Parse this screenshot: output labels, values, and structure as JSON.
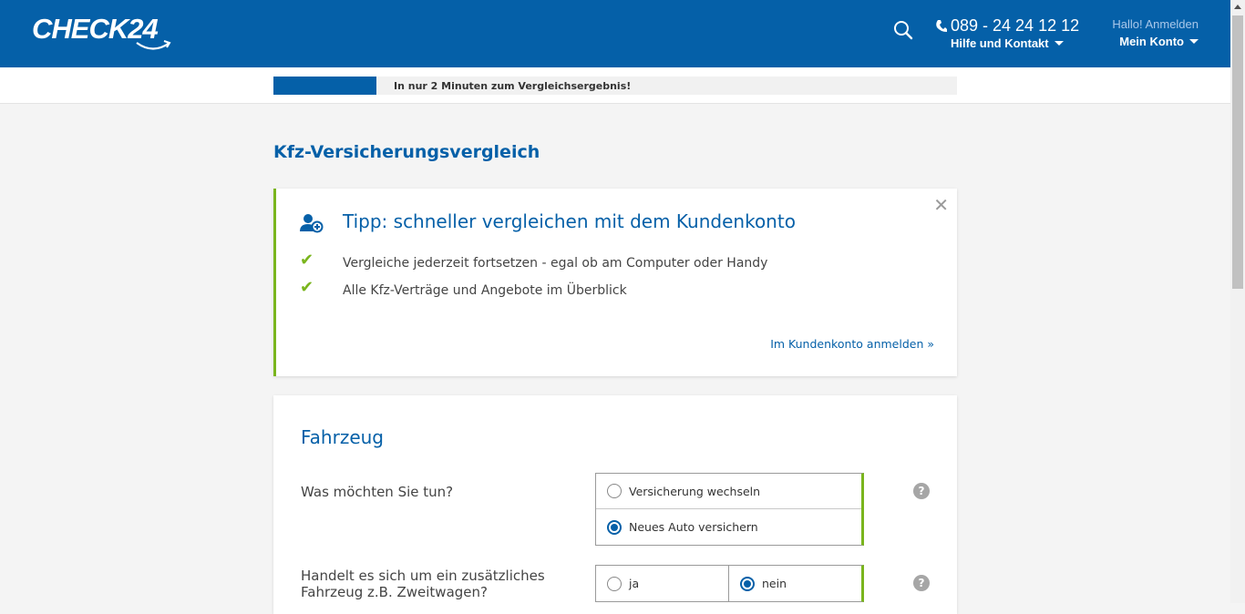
{
  "header": {
    "logo_text": "CHECK24",
    "phone": "089 - 24 24 12 12",
    "help_label": "Hilfe und Kontakt",
    "greeting": "Hallo! Anmelden",
    "account_label": "Mein Konto",
    "brand_color": "#0560a8"
  },
  "progress": {
    "fraction": 0.15,
    "text": "In nur 2 Minuten zum Vergleichsergebnis!"
  },
  "page_title": "Kfz-Versicherungsvergleich",
  "tip": {
    "title": "Tipp: schneller vergleichen mit dem Kundenkonto",
    "items": [
      "Vergleiche jederzeit fortsetzen - egal ob am Computer oder Handy",
      "Alle Kfz-Verträge und Angebote im Überblick"
    ],
    "link": "Im Kundenkonto anmelden »",
    "close_icon": "close-icon",
    "accent_color": "#7ab51d"
  },
  "form": {
    "section_title": "Fahrzeug",
    "questions": [
      {
        "label": "Was möchten Sie tun?",
        "options": [
          "Versicherung wechseln",
          "Neues Auto versichern"
        ],
        "selected": "Neues Auto versichern"
      },
      {
        "label_line1": "Handelt es sich um ein zusätzliches",
        "label_line2": "Fahrzeug z.B. Zweitwagen?",
        "options": [
          "ja",
          "nein"
        ],
        "selected": "nein"
      }
    ]
  }
}
